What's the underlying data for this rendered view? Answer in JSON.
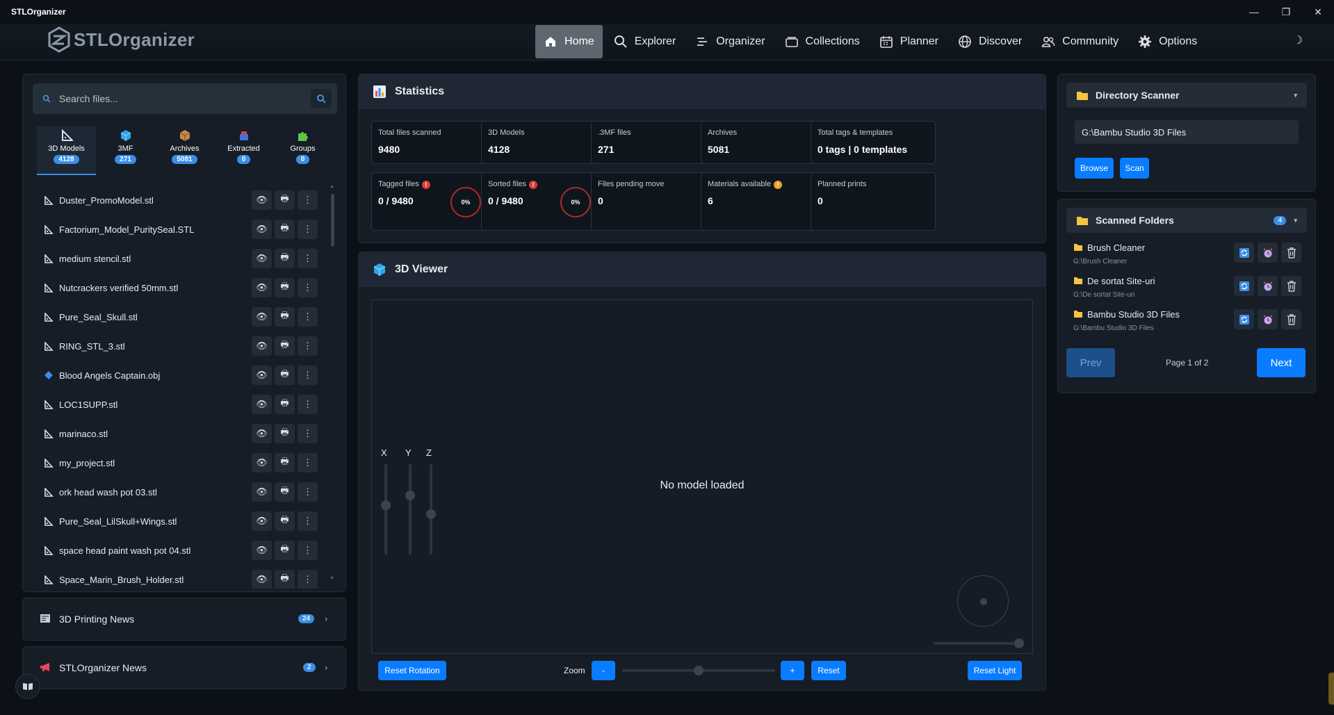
{
  "window": {
    "title": "STLOrganizer",
    "controls": [
      "—",
      "❐",
      "✕"
    ]
  },
  "app": {
    "logo_text": "STLOrganizer",
    "theme_toggle": "☽"
  },
  "nav": [
    {
      "label": "Home",
      "icon": "home-icon",
      "active": true
    },
    {
      "label": "Explorer",
      "icon": "search-icon"
    },
    {
      "label": "Organizer",
      "icon": "sort-lines-icon"
    },
    {
      "label": "Collections",
      "icon": "folder-stack-icon"
    },
    {
      "label": "Planner",
      "icon": "calendar-icon"
    },
    {
      "label": "Discover",
      "icon": "globe-icon"
    },
    {
      "label": "Community",
      "icon": "users-icon"
    },
    {
      "label": "Options",
      "icon": "gear-icon"
    }
  ],
  "left": {
    "search_placeholder": "Search files...",
    "categories": [
      {
        "label": "3D Models",
        "count": "4128",
        "icon": "triangle-ruler-icon",
        "active": true
      },
      {
        "label": "3MF",
        "count": "271",
        "icon": "cube-icon"
      },
      {
        "label": "Archives",
        "count": "5081",
        "icon": "box-icon"
      },
      {
        "label": "Extracted",
        "count": "0",
        "icon": "extract-box-icon"
      },
      {
        "label": "Groups",
        "count": "0",
        "icon": "puzzle-icon"
      }
    ],
    "files": [
      {
        "name": "Duster_PromoModel.stl",
        "icon": "triangle-ruler-icon"
      },
      {
        "name": "Factorium_Model_PuritySeal.STL",
        "icon": "triangle-ruler-icon"
      },
      {
        "name": "medium stencil.stl",
        "icon": "triangle-ruler-icon"
      },
      {
        "name": "Nutcrackers verified 50mm.stl",
        "icon": "triangle-ruler-icon"
      },
      {
        "name": "Pure_Seal_Skull.stl",
        "icon": "triangle-ruler-icon"
      },
      {
        "name": "RING_STL_3.stl",
        "icon": "triangle-ruler-icon"
      },
      {
        "name": "Blood Angels Captain.obj",
        "icon": "diamond-icon"
      },
      {
        "name": "LOC1SUPP.stl",
        "icon": "triangle-ruler-icon"
      },
      {
        "name": "marinaco.stl",
        "icon": "triangle-ruler-icon"
      },
      {
        "name": "my_project.stl",
        "icon": "triangle-ruler-icon"
      },
      {
        "name": "ork head wash pot 03.stl",
        "icon": "triangle-ruler-icon"
      },
      {
        "name": "Pure_Seal_LilSkull+Wings.stl",
        "icon": "triangle-ruler-icon"
      },
      {
        "name": "space head paint wash pot 04.stl",
        "icon": "triangle-ruler-icon"
      },
      {
        "name": "Space_Marin_Brush_Holder.stl",
        "icon": "triangle-ruler-icon"
      }
    ],
    "file_actions": [
      "👁",
      "🖶",
      "⋮"
    ]
  },
  "news": [
    {
      "title": "3D Printing News",
      "count": "24",
      "icon": "newspaper-icon"
    },
    {
      "title": "STLOrganizer News",
      "count": "2",
      "icon": "megaphone-icon"
    }
  ],
  "stats": {
    "title": "Statistics",
    "cards": [
      {
        "label": "Total files scanned",
        "value": "9480"
      },
      {
        "label": "3D Models",
        "value": "4128"
      },
      {
        "label": ".3MF files",
        "value": "271"
      },
      {
        "label": "Archives",
        "value": "5081"
      },
      {
        "label": "Total tags & templates",
        "value": "0 tags | 0 templates"
      },
      {
        "label": "Tagged files",
        "value": "0 / 9480",
        "ring": "0%",
        "warn": "!"
      },
      {
        "label": "Sorted files",
        "value": "0 / 9480",
        "ring": "0%",
        "warn": "!"
      },
      {
        "label": "Files pending move",
        "value": "0"
      },
      {
        "label": "Materials available",
        "value": "6",
        "warn": "!"
      },
      {
        "label": "Planned prints",
        "value": "0"
      }
    ]
  },
  "viewer": {
    "title": "3D Viewer",
    "empty": "No model loaded",
    "axes": [
      "X",
      "Y",
      "Z"
    ],
    "reset_rotation": "Reset Rotation",
    "zoom_label": "Zoom",
    "zoom_minus": "-",
    "zoom_plus": "+",
    "reset": "Reset",
    "reset_light": "Reset Light"
  },
  "scanner": {
    "title": "Directory Scanner",
    "path": "G:\\Bambu Studio 3D Files",
    "browse": "Browse",
    "scan": "Scan"
  },
  "folders": {
    "title": "Scanned Folders",
    "count": "4",
    "items": [
      {
        "name": "Brush Cleaner",
        "path": "G:\\Brush Cleaner"
      },
      {
        "name": "De sortat Site-uri",
        "path": "G:\\De sortat Site-uri"
      },
      {
        "name": "Bambu Studio 3D Files",
        "path": "G:\\Bambu Studio 3D Files"
      }
    ],
    "prev": "Prev",
    "page": "Page 1 of 2",
    "next": "Next"
  },
  "colors": {
    "accent": "#0a7cff",
    "badge": "#3b8ee8",
    "danger": "#b02a2a",
    "warning": "#f0a020",
    "folder": "#f5c542"
  }
}
